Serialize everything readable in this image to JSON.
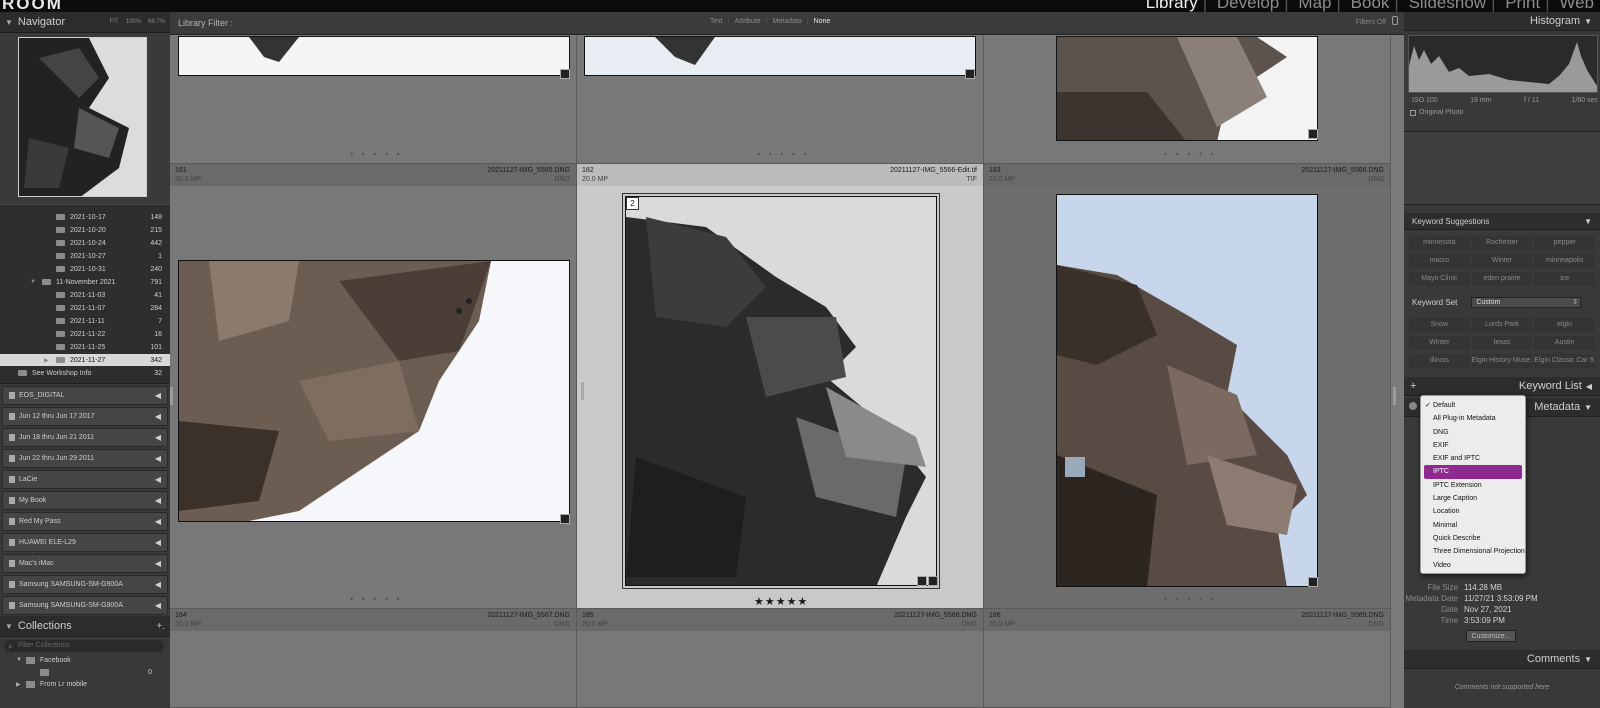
{
  "app": {
    "logo": "ROOM",
    "modules": [
      "Library",
      "Develop",
      "Map",
      "Book",
      "Slideshow",
      "Print",
      "Web"
    ],
    "active_module": "Library"
  },
  "navigator": {
    "title": "Navigator",
    "zoom": [
      "FIT",
      "100%",
      "66.7%"
    ]
  },
  "folders": [
    {
      "name": "2021-10-17",
      "count": "148"
    },
    {
      "name": "2021-10-20",
      "count": "215"
    },
    {
      "name": "2021-10-24",
      "count": "442"
    },
    {
      "name": "2021-10-27",
      "count": "1"
    },
    {
      "name": "2021-10-31",
      "count": "240"
    },
    {
      "name": "11-November 2021",
      "count": "791"
    },
    {
      "name": "2021-11-03",
      "count": "41"
    },
    {
      "name": "2021-11-07",
      "count": "284"
    },
    {
      "name": "2021-11-11",
      "count": "7"
    },
    {
      "name": "2021-11-22",
      "count": "16"
    },
    {
      "name": "2021-11-25",
      "count": "101"
    },
    {
      "name": "2021-11-27",
      "count": "342"
    },
    {
      "name": "See Workshop Info",
      "count": "32"
    }
  ],
  "volumes": [
    "EOS_DIGITAL",
    "Jun 12 thru Jun 17 2017",
    "Jun 18 thru Jun 21 2011",
    "Jun 22 thru Jun 29 2011",
    "LaCie",
    "My Book",
    "Red My Pass",
    "HUAWEI ELE-L29",
    "Mac's iMac",
    "Samsung SAMSUNG-SM-G900A",
    "Samsung SAMSUNG-SM-G900A"
  ],
  "collections": {
    "title": "Collections",
    "search_placeholder": "Filter Collections",
    "items": [
      {
        "name": "Facebook",
        "count": ""
      },
      {
        "name": "",
        "count": "0"
      },
      {
        "name": "From Lr mobile",
        "count": ""
      }
    ]
  },
  "filterbar": {
    "title": "Library Filter :",
    "options": [
      "Text",
      "Attribute",
      "Metadata",
      "None"
    ],
    "active": "None",
    "filters_off": "Filters Off"
  },
  "grid": {
    "cells": [
      {
        "idx": "181",
        "mp": "20.0 MP",
        "file": "20211127-IMG_5565.DNG",
        "ext": "DNG"
      },
      {
        "idx": "182",
        "mp": "20.0 MP",
        "file": "20211127-IMG_5566-Edit.tif",
        "ext": "TIF"
      },
      {
        "idx": "183",
        "mp": "20.0 MP",
        "file": "20211127-IMG_5566.DNG",
        "ext": "DNG"
      },
      {
        "idx": "184",
        "mp": "20.0 MP",
        "file": "20211127-IMG_5567.DNG",
        "ext": "DNG"
      },
      {
        "idx": "185",
        "mp": "20.0 MP",
        "file": "20211127-IMG_5568.DNG",
        "ext": "DNG"
      },
      {
        "idx": "186",
        "mp": "20.0 MP",
        "file": "20211127-IMG_5569.DNG",
        "ext": "DNG"
      }
    ],
    "stack_count": "2",
    "rating": "★★★★★",
    "dots": "• • • • •"
  },
  "histogram": {
    "title": "Histogram",
    "iso": "ISO 100",
    "focal": "19 mm",
    "aperture": "f / 11",
    "shutter": "1/60 sec",
    "original_photo": "Original Photo"
  },
  "keyword_suggestions": {
    "title": "Keyword Suggestions",
    "items": [
      "minnesota",
      "Rochester",
      "pepper",
      "macro",
      "Winter",
      "minneapolis",
      "Mayo Clinic",
      "eden prairie",
      "ice"
    ]
  },
  "keyword_set": {
    "label": "Keyword Set",
    "value": "Custom",
    "items": [
      "Snow",
      "Lords Park",
      "elgin",
      "Winter",
      "texas",
      "Austin",
      "illinois",
      "Elgin History Muse...",
      "Elgin Classic Car S..."
    ]
  },
  "keyword_list": {
    "title": "Keyword List"
  },
  "metadata": {
    "title": "Metadata",
    "rows": [
      {
        "k": "File Size",
        "v": "114.28 MB"
      },
      {
        "k": "Metadata Date",
        "v": "11/27/21 3:53:09 PM"
      },
      {
        "k": "Date",
        "v": "Nov 27, 2021"
      },
      {
        "k": "Time",
        "v": "3:53:09 PM"
      }
    ],
    "customize": "Customize..."
  },
  "comments": {
    "title": "Comments",
    "note": "Comments not supported here"
  },
  "dropdown": {
    "items": [
      "Default",
      "All Plug-in Metadata",
      "DNG",
      "EXIF",
      "EXIF and IPTC",
      "IPTC",
      "IPTC Extension",
      "Large Caption",
      "Location",
      "Minimal",
      "Quick Describe",
      "Three Dimensional Projection",
      "Video"
    ],
    "checked": "Default",
    "highlighted": "IPTC"
  }
}
